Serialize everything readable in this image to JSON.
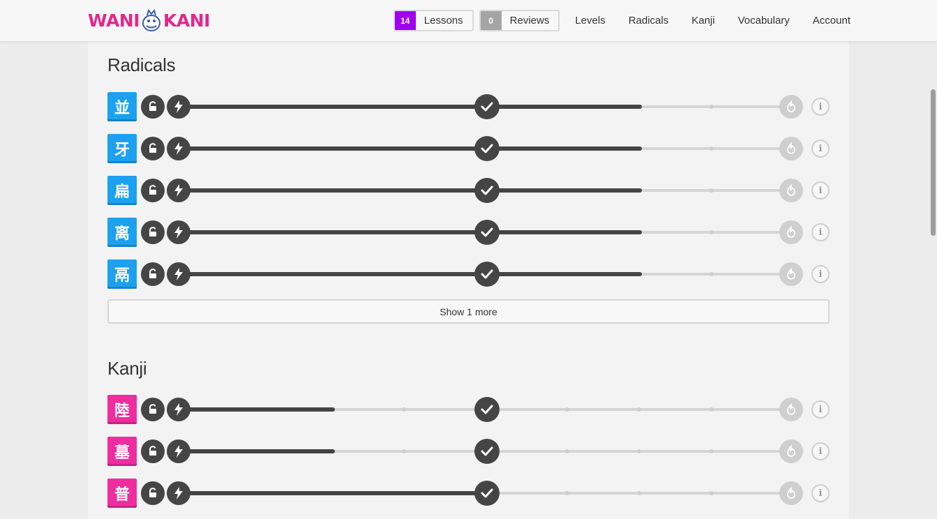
{
  "header": {
    "logo_left": "WANI",
    "logo_right": "KANI",
    "lessons": {
      "count": "14",
      "label": "Lessons"
    },
    "reviews": {
      "count": "0",
      "label": "Reviews"
    },
    "nav": [
      "Levels",
      "Radicals",
      "Kanji",
      "Vocabulary",
      "Account"
    ]
  },
  "radicals": {
    "title": "Radicals",
    "items": [
      {
        "char": "並",
        "progress_stages": 6
      },
      {
        "char": "牙",
        "progress_stages": 6
      },
      {
        "char": "扁",
        "progress_stages": 6
      },
      {
        "char": "离",
        "progress_stages": 6
      },
      {
        "char": "鬲",
        "progress_stages": 6
      }
    ],
    "show_more": "Show 1 more"
  },
  "kanji": {
    "title": "Kanji",
    "items": [
      {
        "char": "陸",
        "progress_stages": 2
      },
      {
        "char": "墓",
        "progress_stages": 2
      },
      {
        "char": "普",
        "progress_stages": 4
      }
    ]
  },
  "colors": {
    "radical": "#1ca1f1",
    "kanji": "#ef2d9e",
    "lessons_badge": "#a100f1",
    "reviews_badge": "#a5a5a5",
    "progress": "#444444"
  },
  "icons": {
    "lock": "unlock-icon",
    "bolt": "lightning-icon",
    "check": "checkmark-icon",
    "burn": "burned-flame-icon",
    "info": "info-icon"
  },
  "info_glyph": "i"
}
